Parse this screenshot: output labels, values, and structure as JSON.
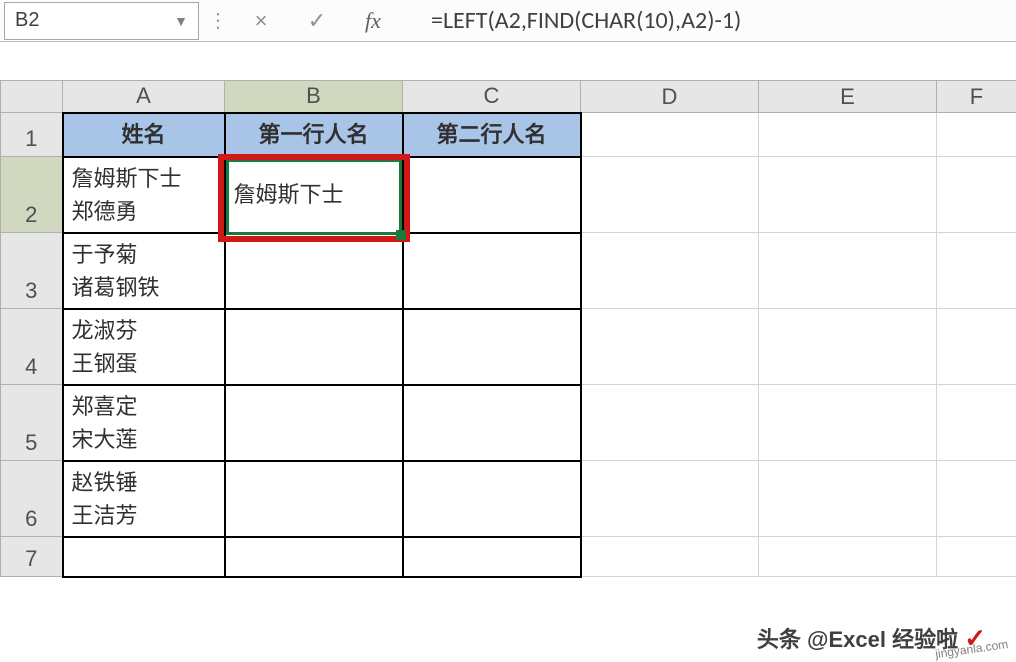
{
  "formula_bar": {
    "name_box": "B2",
    "cancel": "×",
    "confirm": "✓",
    "fx": "fx",
    "formula": "=LEFT(A2,FIND(CHAR(10),A2)-1)"
  },
  "columns": [
    "A",
    "B",
    "C",
    "D",
    "E",
    "F"
  ],
  "row_numbers": [
    "1",
    "2",
    "3",
    "4",
    "5",
    "6",
    "7"
  ],
  "headers": {
    "A": "姓名",
    "B": "第一行人名",
    "C": "第二行人名"
  },
  "rows": [
    {
      "A_line1": "詹姆斯下士",
      "A_line2": "郑德勇",
      "B": "詹姆斯下士",
      "C": ""
    },
    {
      "A_line1": "于予菊",
      "A_line2": "诸葛钢铁",
      "B": "",
      "C": ""
    },
    {
      "A_line1": "龙淑芬",
      "A_line2": "王钢蛋",
      "B": "",
      "C": ""
    },
    {
      "A_line1": "郑喜定",
      "A_line2": "宋大莲",
      "B": "",
      "C": ""
    },
    {
      "A_line1": "赵铁锤",
      "A_line2": "王洁芳",
      "B": "",
      "C": ""
    }
  ],
  "active_cell": "B2",
  "watermark": "头条 @Excel 经验啦",
  "watermark_url": "jingyanla.com",
  "chart_data": {
    "type": "table",
    "title": "",
    "columns": [
      "姓名",
      "第一行人名",
      "第二行人名"
    ],
    "data": [
      [
        "詹姆斯下士\n郑德勇",
        "詹姆斯下士",
        ""
      ],
      [
        "于予菊\n诸葛钢铁",
        "",
        ""
      ],
      [
        "龙淑芬\n王钢蛋",
        "",
        ""
      ],
      [
        "郑喜定\n宋大莲",
        "",
        ""
      ],
      [
        "赵铁锤\n王洁芳",
        "",
        ""
      ]
    ]
  }
}
